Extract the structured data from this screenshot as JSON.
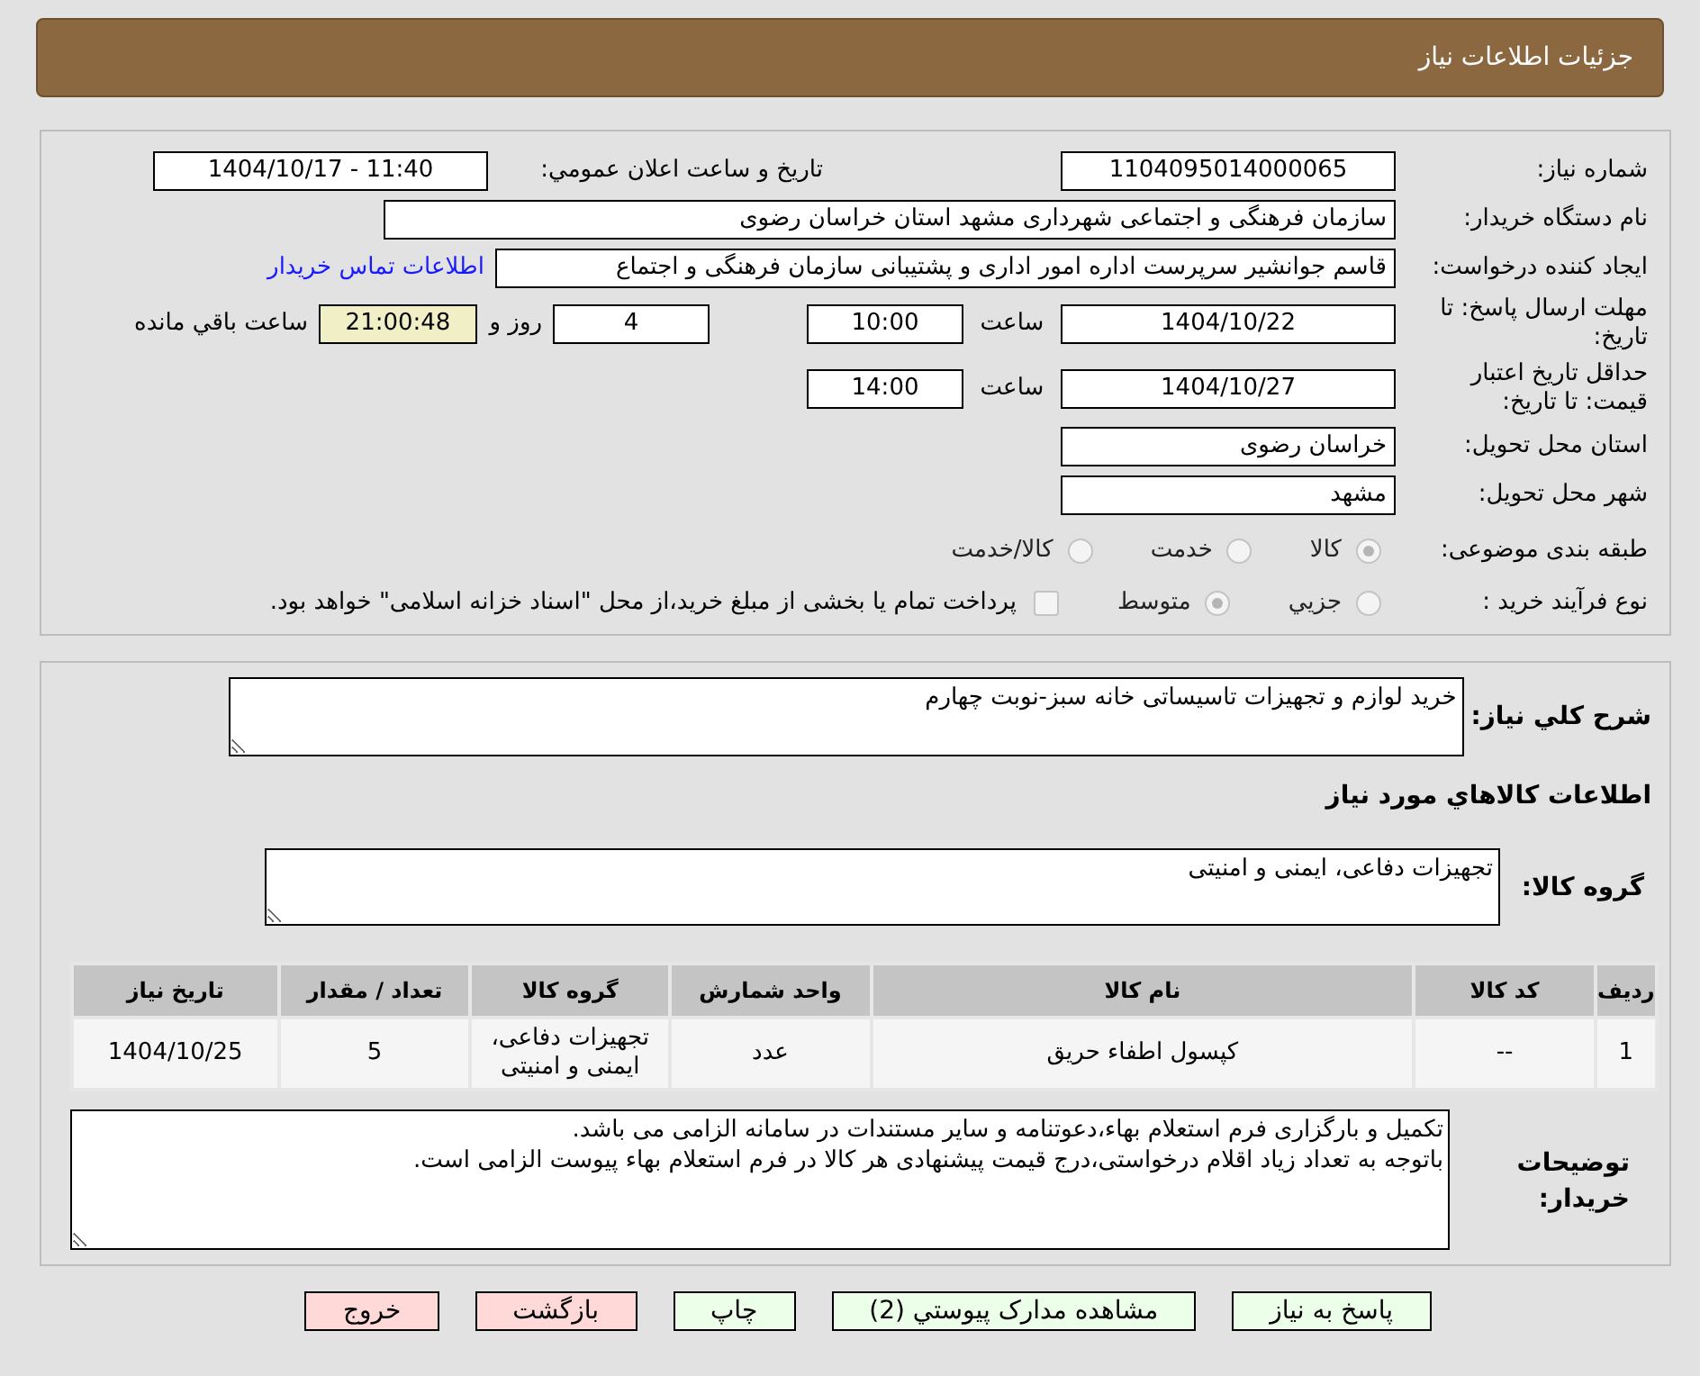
{
  "header": {
    "title": "جزئیات اطلاعات نیاز"
  },
  "need_number": {
    "label": "شماره نیاز:",
    "value": "1104095014000065"
  },
  "announce": {
    "label": "تاريخ و ساعت اعلان عمومي:",
    "value": "1404/10/17 - 11:40"
  },
  "buyer": {
    "label": "نام دستگاه خریدار:",
    "value": "سازمان فرهنگی و اجتماعی شهرداری مشهد استان خراسان رضوی"
  },
  "creator": {
    "label": "ایجاد کننده درخواست:",
    "value": "قاسم جوانشیر سرپرست اداره امور اداری و پشتیبانی سازمان فرهنگی و اجتماع",
    "link": "اطلاعات تماس خریدار"
  },
  "deadline": {
    "label": "مهلت ارسال پاسخ: تا تاریخ:",
    "date": "1404/10/22",
    "time_label": "ساعت",
    "time": "10:00",
    "days": "4",
    "days_label": "روز و",
    "remaining": "21:00:48",
    "remaining_label": "ساعت باقي مانده"
  },
  "validity": {
    "label": "حداقل تاریخ اعتبار قیمت: تا تاریخ:",
    "date": "1404/10/27",
    "time_label": "ساعت",
    "time": "14:00"
  },
  "province": {
    "label": "استان محل تحویل:",
    "value": "خراسان رضوی"
  },
  "city": {
    "label": "شهر محل تحویل:",
    "value": "مشهد"
  },
  "category": {
    "label": "طبقه بندی موضوعی:",
    "options": [
      {
        "label": "کالا",
        "selected": true
      },
      {
        "label": "خدمت",
        "selected": false
      },
      {
        "label": "کالا/خدمت",
        "selected": false
      }
    ]
  },
  "process": {
    "label": "نوع فرآیند خرید :",
    "options": [
      {
        "label": "جزيي",
        "selected": false
      },
      {
        "label": "متوسط",
        "selected": true
      }
    ],
    "payment": {
      "label": "پرداخت تمام یا بخشی از مبلغ خرید،از محل \"اسناد خزانه اسلامی\" خواهد بود.",
      "checked": false
    }
  },
  "description": {
    "label": "شرح كلي نياز:",
    "value": "خرید لوازم و تجهیزات تاسیساتی خانه سبز-نوبت چهارم"
  },
  "goods_heading": "اطلاعات كالاهاي مورد نياز",
  "goods_group": {
    "label": "گروه کالا:",
    "value": "تجهیزات دفاعی، ایمنی و امنیتی"
  },
  "table": {
    "columns": [
      "ردیف",
      "کد کالا",
      "نام کالا",
      "واحد شمارش",
      "گروه کالا",
      "تعداد / مقدار",
      "تاریخ نیاز"
    ],
    "rows": [
      [
        "1",
        "--",
        "کپسول اطفاء حریق",
        "عدد",
        "تجهیزات دفاعی، ایمنی و امنیتی",
        "5",
        "1404/10/25"
      ]
    ]
  },
  "buyer_notes": {
    "label": "توضیحات خریدار:",
    "lines": [
      "تکمیل و بارگزاری فرم استعلام بهاء،دعوتنامه و سایر مستندات در سامانه الزامی می باشد.",
      "باتوجه به تعداد زیاد اقلام درخواستی،درج قیمت پیشنهادی هر کالا در فرم استعلام بهاء پیوست الزامی است."
    ]
  },
  "buttons": [
    {
      "label": "پاسخ به نیاز",
      "kind": "action"
    },
    {
      "label": "مشاهده مدارک پیوستي (2)",
      "kind": "action"
    },
    {
      "label": "چاپ",
      "kind": "action"
    },
    {
      "label": "بازگشت",
      "kind": "exit"
    },
    {
      "label": "خروج",
      "kind": "exit"
    }
  ]
}
